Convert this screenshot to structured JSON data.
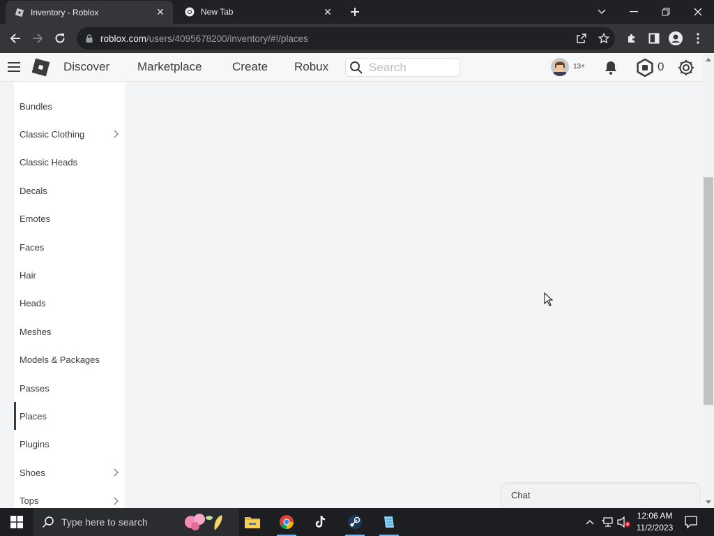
{
  "browser": {
    "tabs": [
      {
        "title": "Inventory - Roblox",
        "icon": "roblox-favicon",
        "active": true
      },
      {
        "title": "New Tab",
        "icon": "chrome-favicon",
        "active": false
      }
    ],
    "url_host": "roblox.com",
    "url_path": "/users/4095678200/inventory/#!/places"
  },
  "header": {
    "nav": [
      "Discover",
      "Marketplace",
      "Create",
      "Robux"
    ],
    "search_placeholder": "Search",
    "age_badge": "13+",
    "robux_count": "0"
  },
  "sidebar": {
    "items": [
      {
        "label": "Bundles",
        "chevron": false,
        "active": false
      },
      {
        "label": "Classic Clothing",
        "chevron": true,
        "active": false
      },
      {
        "label": "Classic Heads",
        "chevron": false,
        "active": false
      },
      {
        "label": "Decals",
        "chevron": false,
        "active": false
      },
      {
        "label": "Emotes",
        "chevron": false,
        "active": false
      },
      {
        "label": "Faces",
        "chevron": false,
        "active": false
      },
      {
        "label": "Hair",
        "chevron": false,
        "active": false
      },
      {
        "label": "Heads",
        "chevron": false,
        "active": false
      },
      {
        "label": "Meshes",
        "chevron": false,
        "active": false
      },
      {
        "label": "Models & Packages",
        "chevron": false,
        "active": false
      },
      {
        "label": "Passes",
        "chevron": false,
        "active": false
      },
      {
        "label": "Places",
        "chevron": false,
        "active": true
      },
      {
        "label": "Plugins",
        "chevron": false,
        "active": false
      },
      {
        "label": "Shoes",
        "chevron": true,
        "active": false
      },
      {
        "label": "Tops",
        "chevron": true,
        "active": false
      }
    ]
  },
  "chat": {
    "label": "Chat"
  },
  "taskbar": {
    "search_placeholder": "Type here to search",
    "apps": [
      "file-explorer-icon",
      "chrome-icon",
      "tiktok-icon",
      "steam-icon",
      "notepad-icon"
    ],
    "time": "12:06 AM",
    "date": "11/2/2023"
  },
  "colors": {
    "chrome_dark": "#202124",
    "chrome_toolbar": "#35363a",
    "page_bg": "#f2f4f5",
    "text": "#393b3d"
  }
}
